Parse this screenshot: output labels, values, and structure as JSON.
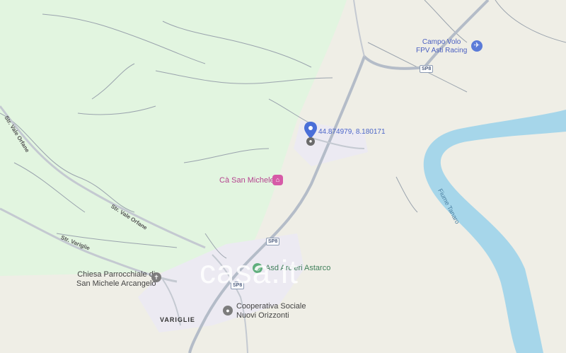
{
  "map": {
    "pin_coordinates": "44.874979, 8.180171",
    "places": {
      "campo_volo": "Campo Volo\nFPV Asti Racing",
      "ca_san_michele": "Cà San Michele",
      "asd_arcieri": "Asd Arcieri Astarco",
      "chiesa": "Chiesa Parrocchiale di\nSan Michele Arcangelo",
      "cooperativa": "Cooperativa Sociale\nNuovi Orizzonti",
      "village": "VARIGLIE"
    },
    "roads": {
      "vale_orfane_1": "Str. Vale Orfane",
      "vale_orfane_2": "Str. Vale Orfane",
      "variglie": "Str. Variglie",
      "sp8_a": "SP8",
      "sp8_b": "SP8",
      "sp8_c": "SP8"
    },
    "river": "Fiume Tanaro",
    "watermark": "casa.it",
    "colors": {
      "forest": "#e2f5e0",
      "land": "#efeee6",
      "urban": "#eceaf2",
      "river": "#a6d6ea",
      "road": "#a9b2bf",
      "pin": "#4a6fd8"
    },
    "icons": {
      "airport": "airplane-icon",
      "hotel": "bed-icon",
      "sport": "target-icon",
      "church": "cross-icon",
      "cooperative": "pin-circle-icon"
    }
  }
}
